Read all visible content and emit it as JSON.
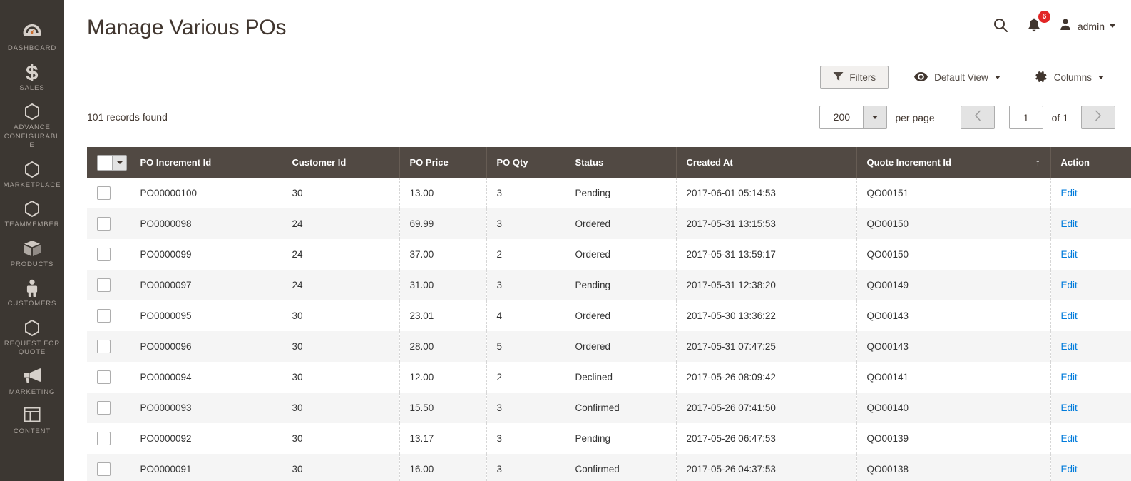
{
  "sidebar": {
    "items": [
      {
        "label": "DASHBOARD",
        "icon": "dashboard-icon"
      },
      {
        "label": "SALES",
        "icon": "dollar-icon"
      },
      {
        "label": "ADVANCE CONFIGURABLE",
        "icon": "hexagon-icon"
      },
      {
        "label": "MARKETPLACE",
        "icon": "hexagon-icon"
      },
      {
        "label": "TEAMMEMBER",
        "icon": "hexagon-icon"
      },
      {
        "label": "PRODUCTS",
        "icon": "box-icon"
      },
      {
        "label": "CUSTOMERS",
        "icon": "person-icon"
      },
      {
        "label": "REQUEST FOR QUOTE",
        "icon": "hexagon-icon"
      },
      {
        "label": "MARKETING",
        "icon": "megaphone-icon"
      },
      {
        "label": "CONTENT",
        "icon": "layout-icon"
      }
    ]
  },
  "header": {
    "title": "Manage Various POs",
    "search_icon": "search-icon",
    "notifications_icon": "bell-icon",
    "notifications_count": "6",
    "admin_icon": "user-icon",
    "admin_name": "admin"
  },
  "toolbar": {
    "filters_label": "Filters",
    "filters_icon": "funnel-icon",
    "view_label": "Default View",
    "view_icon": "eye-icon",
    "columns_label": "Columns",
    "columns_icon": "gear-icon"
  },
  "records": {
    "count_text": "101 records found"
  },
  "pagination": {
    "per_page_value": "200",
    "per_page_label": "per page",
    "prev_icon": "chevron-left-icon",
    "next_icon": "chevron-right-icon",
    "current_page": "1",
    "of_text": "of 1"
  },
  "grid": {
    "columns": [
      {
        "key": "check",
        "label": "",
        "sorted": false,
        "sort_arrow": ""
      },
      {
        "key": "po_id",
        "label": "PO Increment Id",
        "sorted": false,
        "sort_arrow": ""
      },
      {
        "key": "cust",
        "label": "Customer Id",
        "sorted": false,
        "sort_arrow": ""
      },
      {
        "key": "price",
        "label": "PO Price",
        "sorted": false,
        "sort_arrow": ""
      },
      {
        "key": "qty",
        "label": "PO Qty",
        "sorted": false,
        "sort_arrow": ""
      },
      {
        "key": "status",
        "label": "Status",
        "sorted": false,
        "sort_arrow": ""
      },
      {
        "key": "created",
        "label": "Created At",
        "sorted": false,
        "sort_arrow": ""
      },
      {
        "key": "quote",
        "label": "Quote Increment Id",
        "sorted": true,
        "sort_arrow": "↑"
      },
      {
        "key": "action",
        "label": "Action",
        "sorted": false,
        "sort_arrow": ""
      }
    ],
    "action_label": "Edit",
    "rows": [
      {
        "po_id": "PO00000100",
        "cust": "30",
        "price": "13.00",
        "qty": "3",
        "status": "Pending",
        "created": "2017-06-01 05:14:53",
        "quote": "QO00151"
      },
      {
        "po_id": "PO0000098",
        "cust": "24",
        "price": "69.99",
        "qty": "3",
        "status": "Ordered",
        "created": "2017-05-31 13:15:53",
        "quote": "QO00150"
      },
      {
        "po_id": "PO0000099",
        "cust": "24",
        "price": "37.00",
        "qty": "2",
        "status": "Ordered",
        "created": "2017-05-31 13:59:17",
        "quote": "QO00150"
      },
      {
        "po_id": "PO0000097",
        "cust": "24",
        "price": "31.00",
        "qty": "3",
        "status": "Pending",
        "created": "2017-05-31 12:38:20",
        "quote": "QO00149"
      },
      {
        "po_id": "PO0000095",
        "cust": "30",
        "price": "23.01",
        "qty": "4",
        "status": "Ordered",
        "created": "2017-05-30 13:36:22",
        "quote": "QO00143"
      },
      {
        "po_id": "PO0000096",
        "cust": "30",
        "price": "28.00",
        "qty": "5",
        "status": "Ordered",
        "created": "2017-05-31 07:47:25",
        "quote": "QO00143"
      },
      {
        "po_id": "PO0000094",
        "cust": "30",
        "price": "12.00",
        "qty": "2",
        "status": "Declined",
        "created": "2017-05-26 08:09:42",
        "quote": "QO00141"
      },
      {
        "po_id": "PO0000093",
        "cust": "30",
        "price": "15.50",
        "qty": "3",
        "status": "Confirmed",
        "created": "2017-05-26 07:41:50",
        "quote": "QO00140"
      },
      {
        "po_id": "PO0000092",
        "cust": "30",
        "price": "13.17",
        "qty": "3",
        "status": "Pending",
        "created": "2017-05-26 06:47:53",
        "quote": "QO00139"
      },
      {
        "po_id": "PO0000091",
        "cust": "30",
        "price": "16.00",
        "qty": "3",
        "status": "Confirmed",
        "created": "2017-05-26 04:37:53",
        "quote": "QO00138"
      }
    ]
  },
  "colors": {
    "sidebar_bg": "#3c3732",
    "grid_header_bg": "#514943",
    "link": "#007bdb",
    "badge": "#e22626",
    "text": "#41362f"
  }
}
